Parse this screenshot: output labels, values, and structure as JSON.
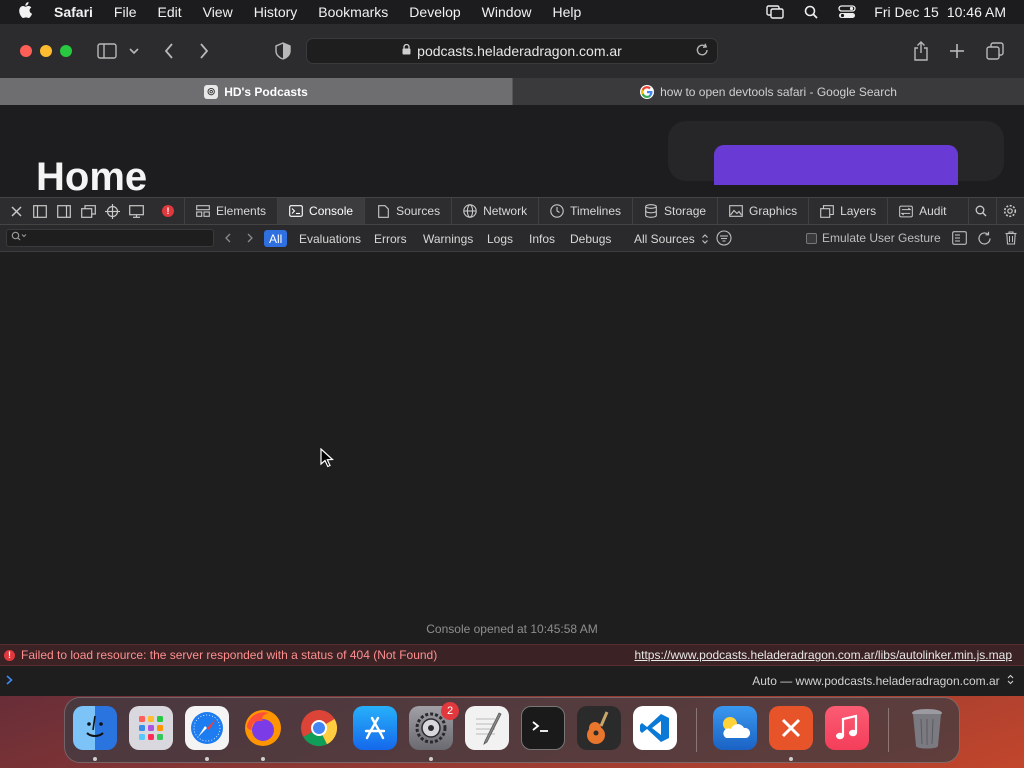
{
  "menubar": {
    "app_name": "Safari",
    "items": [
      "File",
      "Edit",
      "View",
      "History",
      "Bookmarks",
      "Develop",
      "Window",
      "Help"
    ],
    "date": "Fri Dec 15",
    "time": "10:46 AM"
  },
  "toolbar": {
    "url": "podcasts.heladeradragon.com.ar"
  },
  "tabs": [
    {
      "label": "HD's Podcasts",
      "active": true
    },
    {
      "label": "how to open devtools safari - Google Search",
      "active": false
    }
  ],
  "page": {
    "heading": "Home"
  },
  "devtools": {
    "tabs": [
      {
        "label": "Elements",
        "icon": "elements-icon"
      },
      {
        "label": "Console",
        "icon": "console-icon",
        "active": true
      },
      {
        "label": "Sources",
        "icon": "sources-icon"
      },
      {
        "label": "Network",
        "icon": "network-icon"
      },
      {
        "label": "Timelines",
        "icon": "timelines-icon"
      },
      {
        "label": "Storage",
        "icon": "storage-icon"
      },
      {
        "label": "Graphics",
        "icon": "graphics-icon"
      },
      {
        "label": "Layers",
        "icon": "layers-icon"
      },
      {
        "label": "Audit",
        "icon": "audit-icon"
      }
    ],
    "filters": {
      "levels": [
        "All",
        "Evaluations",
        "Errors",
        "Warnings",
        "Logs",
        "Infos",
        "Debugs"
      ],
      "active_level": "All",
      "sources_select": "All Sources",
      "emulate_label": "Emulate User Gesture"
    },
    "console": {
      "opened_message": "Console opened at 10:45:58 AM",
      "error_message": "Failed to load resource: the server responded with a status of 404 (Not Found)",
      "error_url": "https://www.podcasts.heladeradragon.com.ar/libs/autolinker.min.js.map",
      "context": "Auto — www.podcasts.heladeradragon.com.ar"
    }
  },
  "dock": {
    "items": [
      {
        "name": "Finder",
        "color": "#3a8ee8"
      },
      {
        "name": "Launchpad",
        "color": "#d9d9dd"
      },
      {
        "name": "Safari",
        "color": "#1c7cf0"
      },
      {
        "name": "Firefox",
        "color": "#e8672a"
      },
      {
        "name": "Chrome",
        "color": "#ffffff"
      },
      {
        "name": "App Store",
        "color": "#1d8cf5"
      },
      {
        "name": "System Settings",
        "color": "#8e8e93",
        "badge": "2"
      },
      {
        "name": "TextEdit",
        "color": "#f0f0f0"
      },
      {
        "name": "Terminal",
        "color": "#1a1a1a"
      },
      {
        "name": "GarageBand",
        "color": "#3a3a3a"
      },
      {
        "name": "Visual Studio Code",
        "color": "#ffffff"
      },
      {
        "name": "Weather",
        "color": "#2a82e4"
      },
      {
        "name": "Remote Desktop",
        "color": "#e8542a"
      },
      {
        "name": "Music",
        "color": "#f43e5a"
      },
      {
        "name": "Trash",
        "color": "#5a5a5e"
      }
    ]
  }
}
